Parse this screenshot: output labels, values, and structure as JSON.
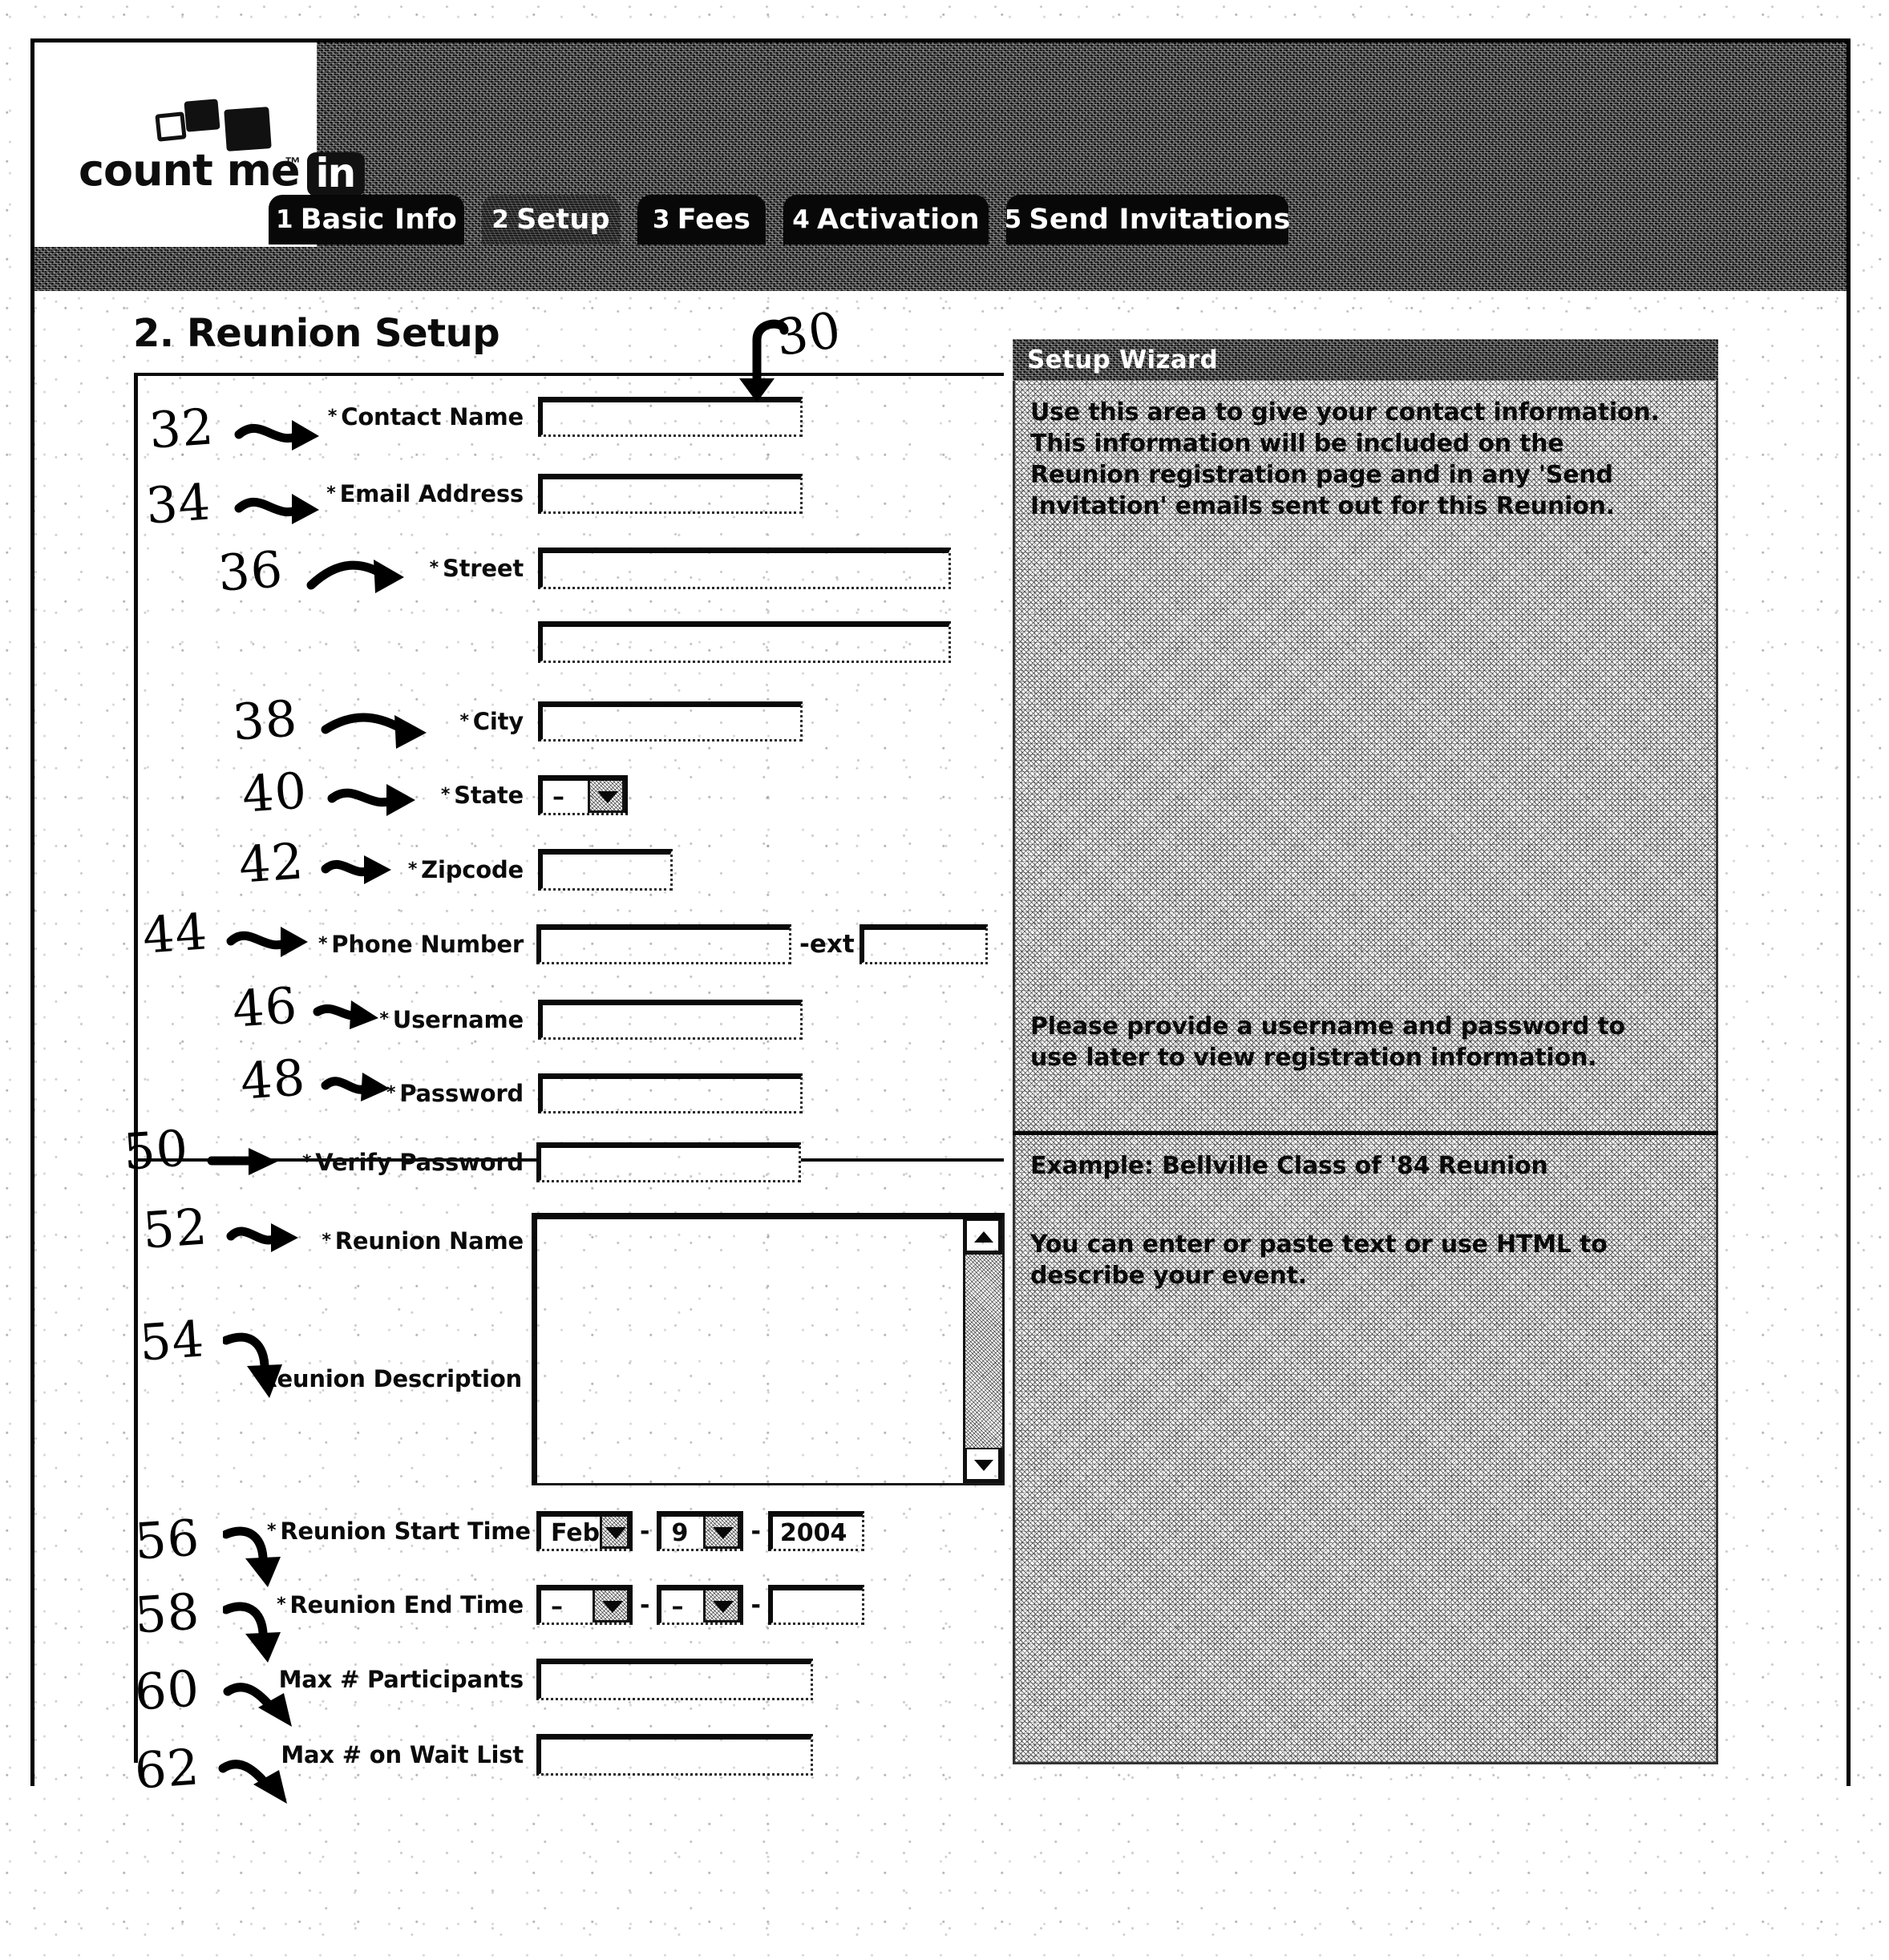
{
  "figure": {
    "callout_main": "30"
  },
  "header": {
    "logo": {
      "wordmark": "count me",
      "badge": "in",
      "trademark": "™"
    },
    "tabs": [
      {
        "num": "1",
        "label": "Basic Info",
        "active": false
      },
      {
        "num": "2",
        "label": "Setup",
        "active": true
      },
      {
        "num": "3",
        "label": "Fees",
        "active": false
      },
      {
        "num": "4",
        "label": "Activation",
        "active": false
      },
      {
        "num": "5",
        "label": "Send Invitations",
        "active": false
      }
    ]
  },
  "page": {
    "title": "2. Reunion Setup"
  },
  "form": {
    "required_mark": "*",
    "ext_separator": "-ext",
    "date_separator": "-",
    "contact_section": [
      {
        "ref": "32",
        "label": "Contact Name",
        "required": true,
        "value": ""
      },
      {
        "ref": "34",
        "label": "Email Address",
        "required": true,
        "value": ""
      },
      {
        "ref": "36",
        "label": "Street",
        "required": true,
        "value": ""
      },
      {
        "ref": "",
        "label": "",
        "required": false,
        "value": ""
      },
      {
        "ref": "38",
        "label": "City",
        "required": true,
        "value": ""
      },
      {
        "ref": "40",
        "label": "State",
        "required": true,
        "value": "–"
      },
      {
        "ref": "42",
        "label": "Zipcode",
        "required": true,
        "value": ""
      },
      {
        "ref": "44",
        "label": "Phone Number",
        "required": true,
        "value": "",
        "ext": ""
      },
      {
        "ref": "46",
        "label": "Username",
        "required": true,
        "value": ""
      },
      {
        "ref": "48",
        "label": "Password",
        "required": true,
        "value": ""
      },
      {
        "ref": "50",
        "label": "Verify Password",
        "required": true,
        "value": ""
      }
    ],
    "reunion_section": [
      {
        "ref": "52",
        "label": "Reunion Name",
        "required": true,
        "value": ""
      },
      {
        "ref": "54",
        "label": "Reunion Description",
        "required": false,
        "value": ""
      },
      {
        "ref": "56",
        "label": "Reunion Start Time",
        "required": true
      },
      {
        "ref": "58",
        "label": "Reunion End Time",
        "required": true
      },
      {
        "ref": "60",
        "label": "Max # Participants",
        "required": false,
        "value": ""
      },
      {
        "ref": "62",
        "label": "Max # on Wait List",
        "required": false,
        "value": ""
      }
    ],
    "start_time": {
      "month": "Feb",
      "day": "9",
      "year": "2004"
    },
    "end_time": {
      "month": "–",
      "day": "–",
      "year": ""
    }
  },
  "wizard": {
    "title": "Setup Wizard",
    "top_paragraph_1": "Use this area to give your contact information. This information will be included on the Reunion registration page and in any 'Send Invitation' emails sent out for this Reunion.",
    "top_paragraph_2": "Please provide a username and password to use later to view registration information.",
    "bottom_paragraph_1": "Example: Bellville Class of '84 Reunion",
    "bottom_paragraph_2": "You can enter or paste text or use HTML to describe your event."
  },
  "colors": {
    "ink": "#0a0a0a",
    "paper": "#ffffff"
  }
}
